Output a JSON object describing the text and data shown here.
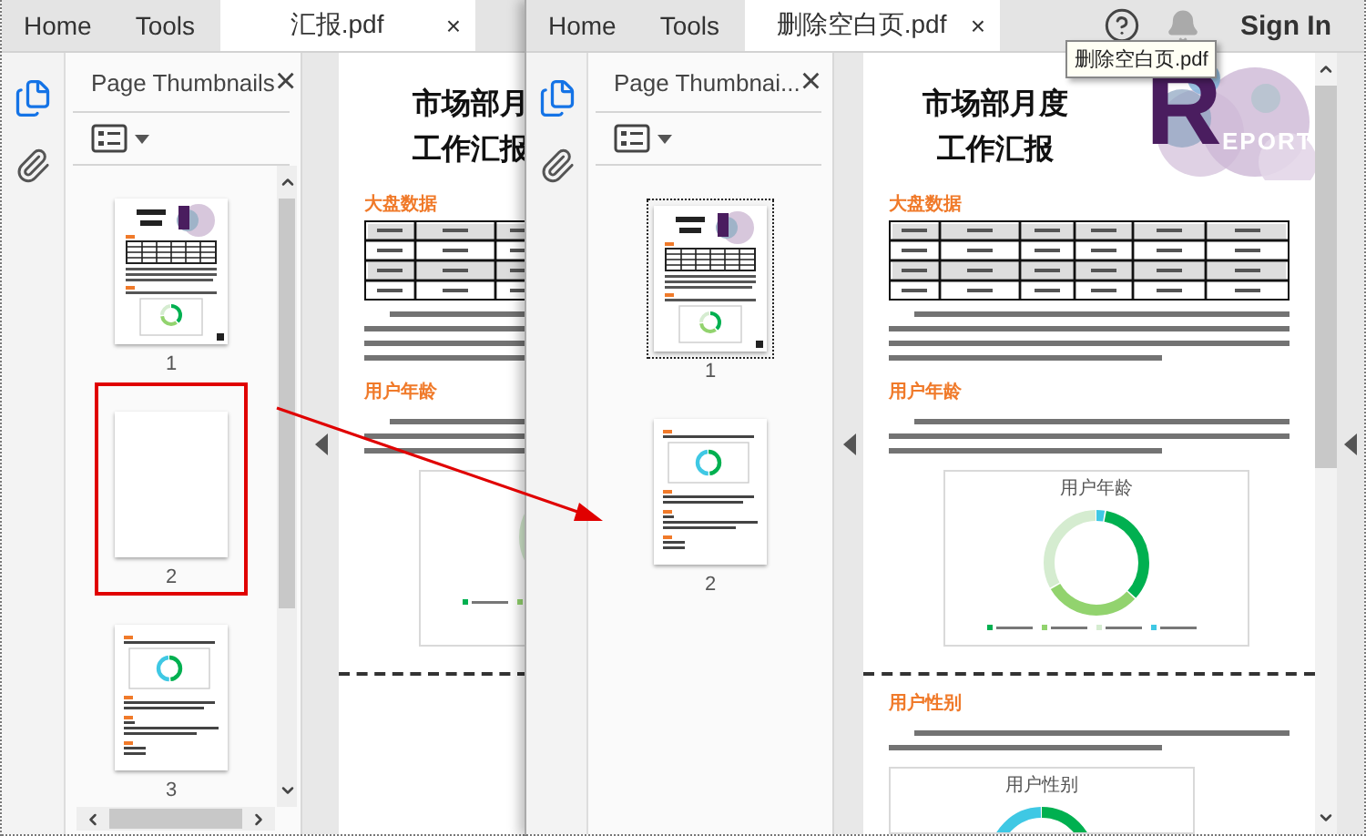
{
  "windows": [
    {
      "tabs": [
        {
          "label": "Home",
          "selected": false
        },
        {
          "label": "Tools",
          "selected": false
        },
        {
          "label": "汇报.pdf",
          "selected": true,
          "close": "×"
        }
      ],
      "panel": {
        "title": "Page Thumbnails",
        "close": "×",
        "scrollbars": true
      },
      "thumbnails": [
        {
          "label": "1",
          "kind": "report",
          "selected": false,
          "highlighted": false
        },
        {
          "label": "2",
          "kind": "blank",
          "selected": false,
          "highlighted": true
        },
        {
          "label": "3",
          "kind": "charts",
          "selected": false,
          "highlighted": false
        }
      ],
      "document": {
        "title": [
          "市场部月",
          "工作汇报"
        ],
        "sections": [
          {
            "kind": "heading",
            "text": "大盘数据"
          },
          {
            "kind": "table"
          },
          {
            "kind": "paragraph"
          },
          {
            "kind": "heading",
            "text": "用户年龄"
          },
          {
            "kind": "paragraph"
          },
          {
            "kind": "chart"
          },
          {
            "kind": "page_break"
          }
        ]
      }
    },
    {
      "tabs": [
        {
          "label": "Home",
          "selected": false
        },
        {
          "label": "Tools",
          "selected": false
        },
        {
          "label": "删除空白页.pdf",
          "selected": true,
          "close": "×"
        }
      ],
      "tooltip": "删除空白页.pdf",
      "sign_in": "Sign In",
      "panel": {
        "title": "Page Thumbnai...",
        "close": "×"
      },
      "thumbnails": [
        {
          "label": "1",
          "kind": "report",
          "selected": true,
          "highlighted": false
        },
        {
          "label": "2",
          "kind": "charts",
          "selected": false,
          "highlighted": false
        }
      ],
      "document": {
        "title": [
          "市场部月度",
          "工作汇报"
        ],
        "logo": {
          "letter": "R",
          "text": "EPORT"
        },
        "scrollbar": true,
        "sections": [
          {
            "kind": "heading",
            "text": "大盘数据"
          },
          {
            "kind": "table"
          },
          {
            "kind": "paragraph"
          },
          {
            "kind": "heading",
            "text": "用户年龄"
          },
          {
            "kind": "paragraph"
          },
          {
            "kind": "chart",
            "title": "用户年龄"
          },
          {
            "kind": "page_break"
          },
          {
            "kind": "heading",
            "text": "用户性别"
          },
          {
            "kind": "paragraph"
          },
          {
            "kind": "chart",
            "title": "用户性别"
          }
        ]
      }
    }
  ]
}
